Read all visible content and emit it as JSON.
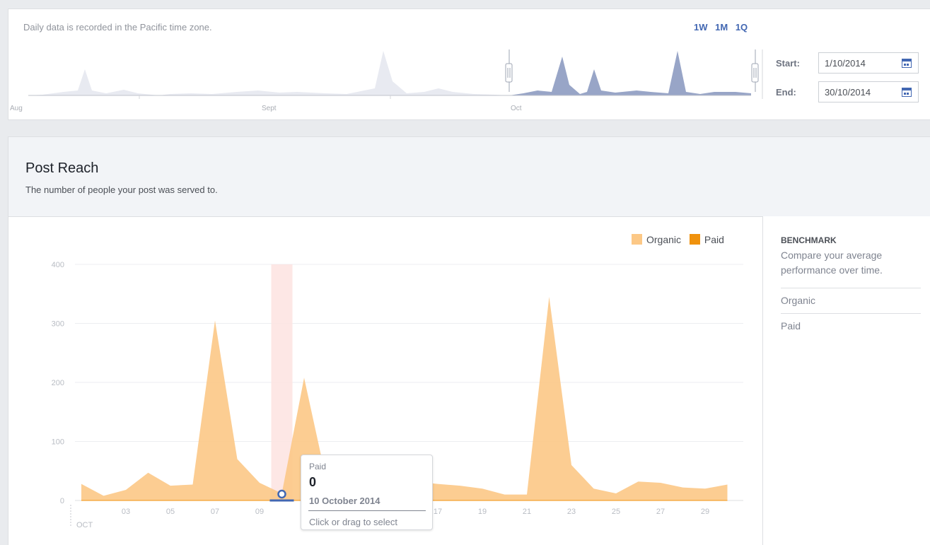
{
  "range_selector": {
    "note": "Daily data is recorded in the Pacific time zone.",
    "buttons": [
      "1W",
      "1M",
      "1Q"
    ],
    "month_labels": [
      "Aug",
      "Sept",
      "Oct"
    ],
    "start_label": "Start:",
    "start_value": "1/10/2014",
    "end_label": "End:",
    "end_value": "30/10/2014"
  },
  "header": {
    "title": "Post Reach",
    "subtitle": "The number of people your post was served to."
  },
  "benchmark": {
    "title": "BENCHMARK",
    "description": "Compare your average performance over time.",
    "items": [
      "Organic",
      "Paid"
    ]
  },
  "tooltip": {
    "series": "Paid",
    "value": "0",
    "date": "10 October 2014",
    "hint": "Click or drag to select"
  },
  "colors": {
    "organic": "#fcc886",
    "paid": "#f0920d",
    "accent": "#4267b2",
    "highlight": "#fde3e0"
  },
  "chart_data": {
    "type": "area",
    "title": "Post Reach",
    "x_axis_label": "OCT",
    "x": [
      1,
      2,
      3,
      4,
      5,
      6,
      7,
      8,
      9,
      10,
      11,
      12,
      13,
      14,
      15,
      16,
      17,
      18,
      19,
      20,
      21,
      22,
      23,
      24,
      25,
      26,
      27,
      28,
      29,
      30
    ],
    "x_tick_labels": [
      "03",
      "05",
      "07",
      "09",
      "11",
      "13",
      "15",
      "17",
      "19",
      "21",
      "23",
      "25",
      "27",
      "29"
    ],
    "x_tick_values": [
      3,
      5,
      7,
      9,
      11,
      13,
      15,
      17,
      19,
      21,
      23,
      25,
      27,
      29
    ],
    "y_ticks": [
      0,
      100,
      200,
      300,
      400
    ],
    "ylim": [
      0,
      400
    ],
    "legend": [
      "Organic",
      "Paid"
    ],
    "legend_position": "top-right",
    "grid": true,
    "highlighted_x": 10,
    "series": [
      {
        "name": "Organic",
        "values": [
          28,
          8,
          18,
          47,
          25,
          27,
          305,
          70,
          30,
          12,
          208,
          35,
          22,
          20,
          15,
          32,
          28,
          25,
          20,
          10,
          10,
          345,
          60,
          20,
          12,
          32,
          30,
          22,
          20,
          27
        ]
      },
      {
        "name": "Paid",
        "values": [
          0,
          0,
          0,
          0,
          0,
          0,
          0,
          0,
          0,
          0,
          0,
          0,
          0,
          0,
          0,
          0,
          0,
          0,
          0,
          0,
          0,
          0,
          0,
          0,
          0,
          0,
          0,
          0,
          0,
          0
        ]
      }
    ]
  }
}
